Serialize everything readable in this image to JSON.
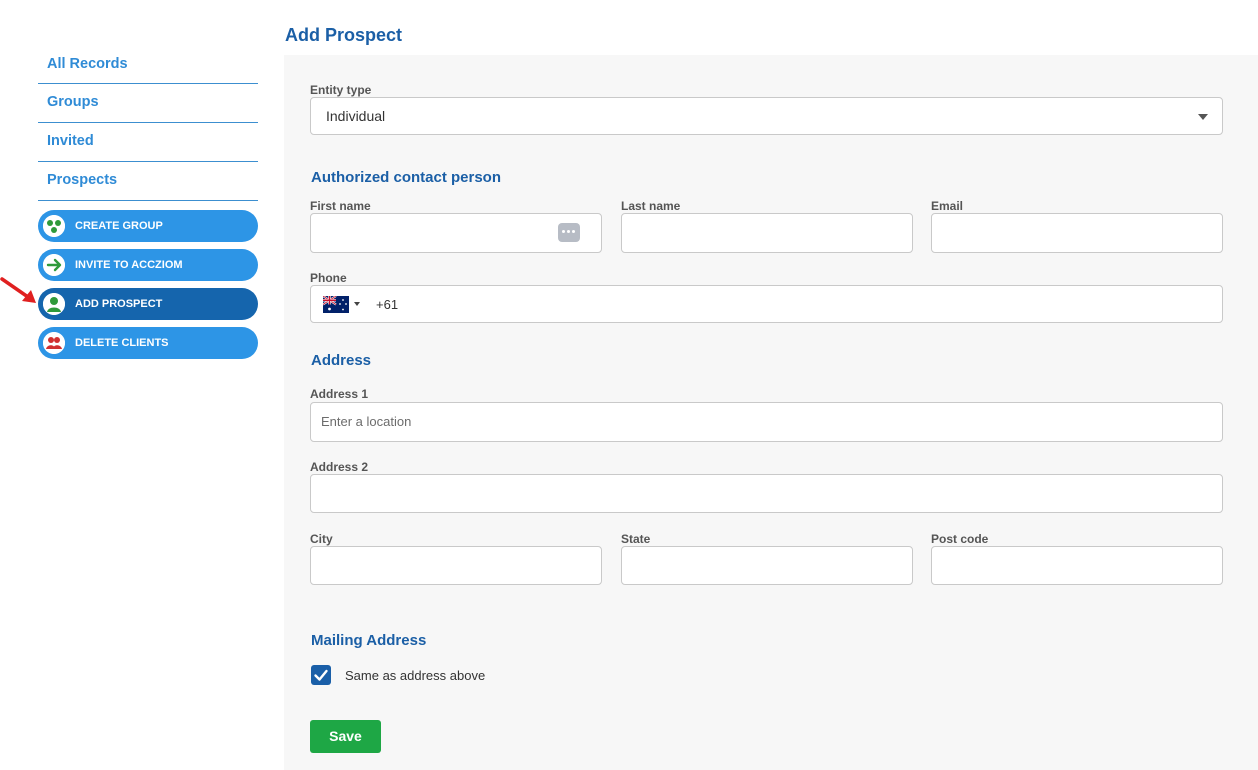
{
  "sidebar": {
    "nav": [
      {
        "label": "All Records"
      },
      {
        "label": "Groups"
      },
      {
        "label": "Invited"
      },
      {
        "label": "Prospects"
      }
    ],
    "actions": [
      {
        "label": "CREATE GROUP",
        "icon": "group-icon"
      },
      {
        "label": "INVITE TO ACCZIOM",
        "icon": "arrow-right-icon"
      },
      {
        "label": "ADD PROSPECT",
        "icon": "user-icon",
        "active": true
      },
      {
        "label": "DELETE CLIENTS",
        "icon": "users-delete-icon"
      }
    ]
  },
  "page": {
    "title": "Add Prospect"
  },
  "form": {
    "entity_type": {
      "label": "Entity type",
      "value": "Individual"
    },
    "contact_section": "Authorized contact person",
    "first_name": {
      "label": "First name",
      "value": ""
    },
    "last_name": {
      "label": "Last name",
      "value": ""
    },
    "email": {
      "label": "Email",
      "value": ""
    },
    "phone": {
      "label": "Phone",
      "code": "+61",
      "country": "Australia"
    },
    "address_section": "Address",
    "address1": {
      "label": "Address 1",
      "placeholder": "Enter a location"
    },
    "address2": {
      "label": "Address 2",
      "value": ""
    },
    "city": {
      "label": "City",
      "value": ""
    },
    "state": {
      "label": "State",
      "value": ""
    },
    "postcode": {
      "label": "Post code",
      "value": ""
    },
    "mailing_section": "Mailing Address",
    "same_as_above": {
      "label": "Same as address above",
      "checked": true
    },
    "save_label": "Save"
  },
  "colors": {
    "accent": "#2d95e6",
    "active": "#1565ad",
    "title": "#1b5fa6",
    "save": "#1ea745",
    "arrow": "#e02020"
  }
}
